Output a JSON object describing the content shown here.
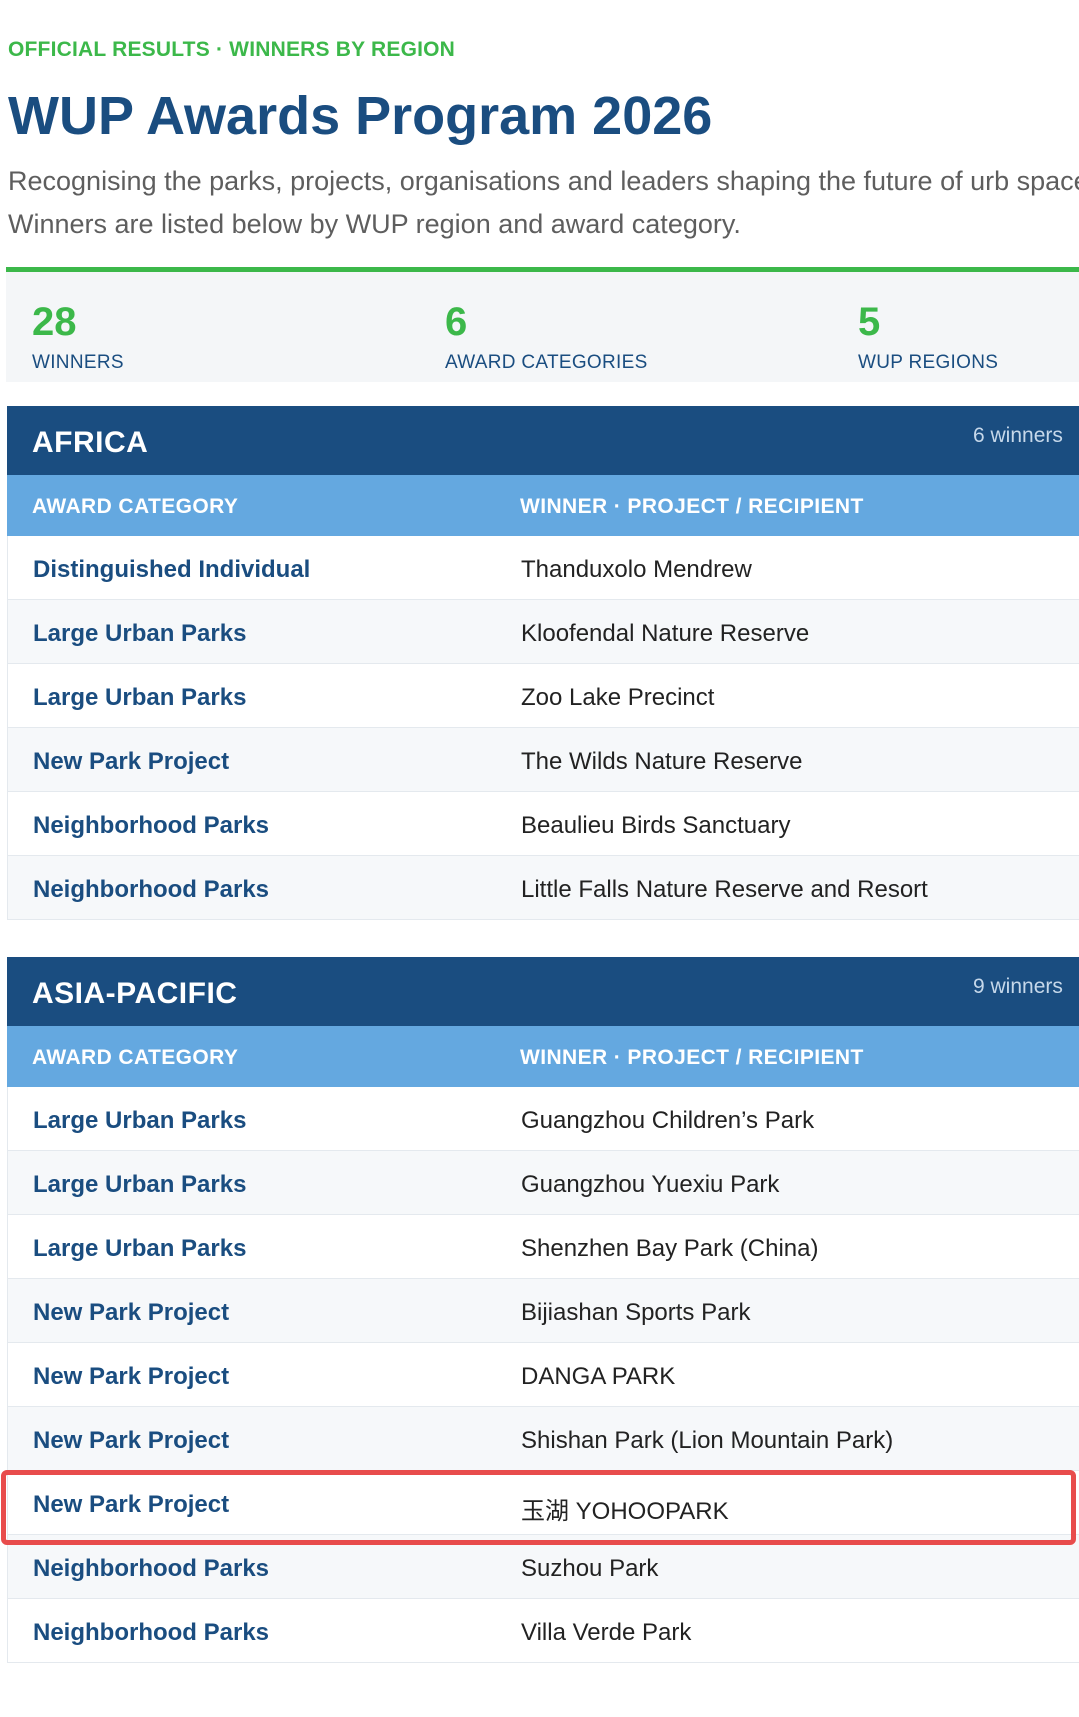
{
  "header": {
    "eyebrow": "OFFICIAL RESULTS · WINNERS BY REGION",
    "title": "WUP Awards Program 2026",
    "subtitle": "Recognising the parks, projects, organisations and leaders shaping the future of urb spaces. Winners are listed below by WUP region and award category."
  },
  "stats": [
    {
      "value": "28",
      "label": "WINNERS"
    },
    {
      "value": "6",
      "label": "AWARD CATEGORIES"
    },
    {
      "value": "5",
      "label": "WUP REGIONS"
    }
  ],
  "columns": {
    "category": "AWARD CATEGORY",
    "winner": "WINNER · PROJECT / RECIPIENT"
  },
  "regions": [
    {
      "name": "AFRICA",
      "count": "6 winners",
      "rows": [
        {
          "category": "Distinguished Individual",
          "winner": "Thanduxolo Mendrew"
        },
        {
          "category": "Large Urban Parks",
          "winner": "Kloofendal Nature Reserve"
        },
        {
          "category": "Large Urban Parks",
          "winner": "Zoo Lake Precinct"
        },
        {
          "category": "New Park Project",
          "winner": "The Wilds Nature Reserve"
        },
        {
          "category": "Neighborhood Parks",
          "winner": "Beaulieu Birds Sanctuary"
        },
        {
          "category": "Neighborhood Parks",
          "winner": "Little Falls Nature Reserve and Resort"
        }
      ]
    },
    {
      "name": "ASIA-PACIFIC",
      "count": "9 winners",
      "rows": [
        {
          "category": "Large Urban Parks",
          "winner": "Guangzhou Children’s Park"
        },
        {
          "category": "Large Urban Parks",
          "winner": "Guangzhou Yuexiu Park"
        },
        {
          "category": "Large Urban Parks",
          "winner": "Shenzhen Bay Park (China)"
        },
        {
          "category": "New Park Project",
          "winner": "Bijiashan Sports Park"
        },
        {
          "category": "New Park Project",
          "winner": "DANGA PARK"
        },
        {
          "category": "New Park Project",
          "winner": "Shishan Park (Lion Mountain Park)"
        },
        {
          "category": "New Park Project",
          "winner": "玉湖 YOHOOPARK"
        },
        {
          "category": "Neighborhood Parks",
          "winner": "Suzhou Park"
        },
        {
          "category": "Neighborhood Parks",
          "winner": "Villa Verde Park"
        }
      ]
    }
  ],
  "colors": {
    "accent_green": "#3cb84a",
    "navy": "#1a4d80",
    "column_header_blue": "#64a8e0",
    "highlight_red": "#e84c4c"
  }
}
